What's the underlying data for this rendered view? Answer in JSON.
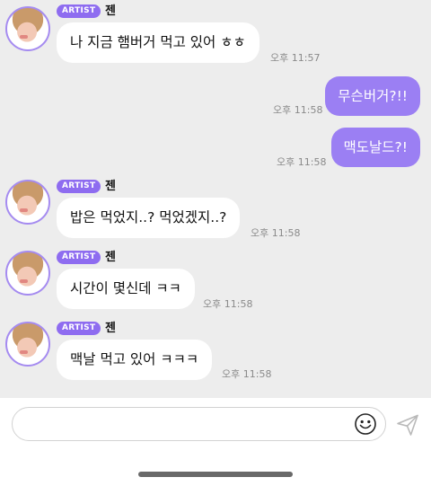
{
  "messages": [
    {
      "badge": "ARTIST",
      "sender": "젠",
      "text": "나 지금 햄버거 먹고 있어 ㅎㅎ",
      "time": "오후 11:57"
    },
    {
      "text": "무슨버거?!!",
      "time": "오후 11:58"
    },
    {
      "text": "맥도날드?!",
      "time": "오후 11:58"
    },
    {
      "badge": "ARTIST",
      "sender": "젠",
      "text": "밥은 먹었지..? 먹었겠지..?",
      "time": "오후 11:58"
    },
    {
      "badge": "ARTIST",
      "sender": "젠",
      "text": "시간이 몇신데 ㅋㅋ",
      "time": "오후 11:58"
    },
    {
      "badge": "ARTIST",
      "sender": "젠",
      "text": "맥날 먹고 있어 ㅋㅋㅋ",
      "time": "오후 11:58"
    }
  ],
  "composer": {
    "placeholder": "",
    "emoji_icon": "smiley-icon",
    "send_icon": "paper-plane-icon"
  },
  "colors": {
    "background": "#ededed",
    "accent": "#9b7ff3",
    "badge": "#8e6cf0",
    "incoming_bubble": "#ffffff"
  }
}
